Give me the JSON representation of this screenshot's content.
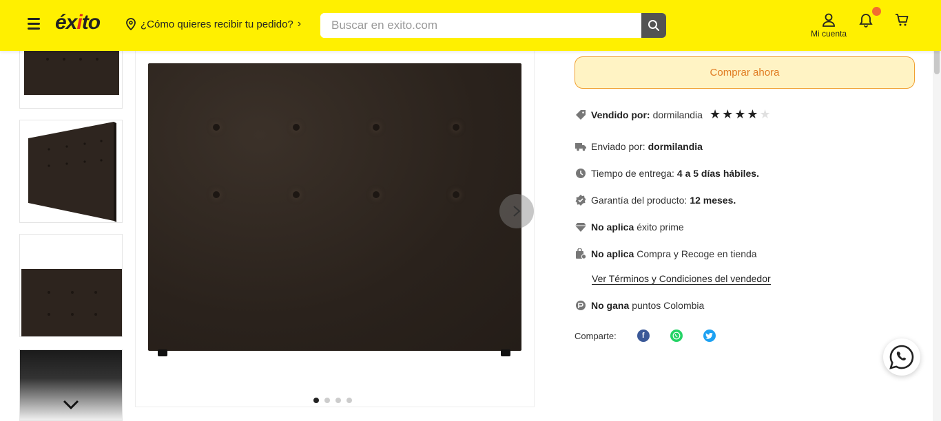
{
  "header": {
    "logo": "éxito",
    "location_prompt": "¿Cómo quieres recibir tu pedido?",
    "search_placeholder": "Buscar en exito.com",
    "account_label": "Mi cuenta",
    "notification_badge_color": "#f26b30",
    "brand_color": "#fff000"
  },
  "gallery": {
    "active_slide": 1,
    "slide_count": 4
  },
  "purchase": {
    "buy_now_label": "Comprar ahora"
  },
  "seller": {
    "sold_by_label": "Vendido por:",
    "sold_by_value": "dormilandia",
    "rating": 4,
    "rating_max": 5
  },
  "details": {
    "shipped_by_label": "Enviado por:",
    "shipped_by_value": "dormilandia",
    "delivery_label": "Tiempo de entrega:",
    "delivery_value": "4 a 5 días hábiles.",
    "warranty_label": "Garantía del producto:",
    "warranty_value": "12 meses.",
    "prime_bold": "No aplica",
    "prime_text": "éxito prime",
    "pickup_bold": "No aplica",
    "pickup_text": "Compra y Recoge en tienda",
    "terms_link": "Ver Términos y Condiciones del vendedor",
    "points_bold": "No gana",
    "points_text": "puntos Colombia"
  },
  "share": {
    "label": "Comparte:",
    "facebook_color": "#3b5998",
    "whatsapp_color": "#25d366",
    "twitter_color": "#1da1f2"
  }
}
